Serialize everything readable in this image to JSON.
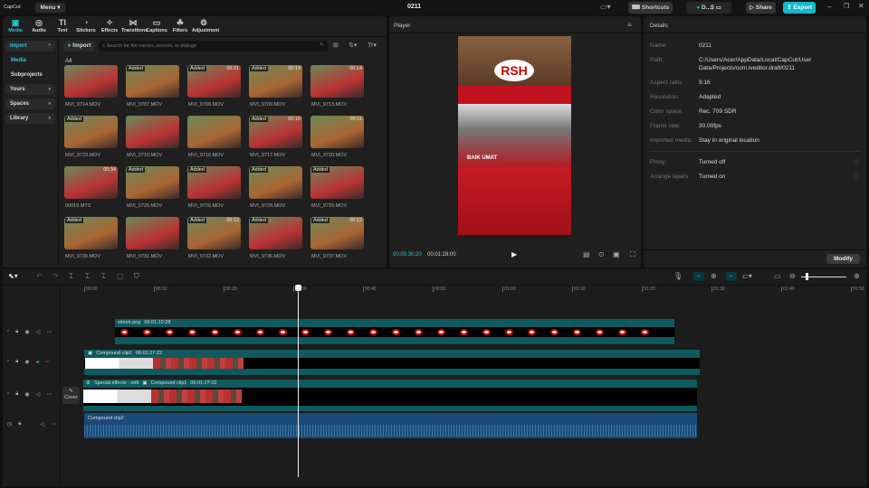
{
  "app": {
    "logo": "CapCut",
    "menu": "Menu",
    "project_title": "0211",
    "shortcuts": "Shortcuts",
    "user": "D...$",
    "share": "Share",
    "export": "Export",
    "accent": "#17b8c9"
  },
  "tabs": [
    {
      "label": "Media",
      "icon": "media-icon"
    },
    {
      "label": "Audio",
      "icon": "audio-icon"
    },
    {
      "label": "Text",
      "icon": "text-icon"
    },
    {
      "label": "Stickers",
      "icon": "stickers-icon"
    },
    {
      "label": "Effects",
      "icon": "effects-icon"
    },
    {
      "label": "Transitions",
      "icon": "transitions-icon"
    },
    {
      "label": "Captions",
      "icon": "captions-icon"
    },
    {
      "label": "Filters",
      "icon": "filters-icon"
    },
    {
      "label": "Adjustment",
      "icon": "adjustment-icon"
    }
  ],
  "sidebar": {
    "import": "Import",
    "media": "Media",
    "subprojects": "Subprojects",
    "yours": "Yours",
    "spaces": "Spaces",
    "library": "Library"
  },
  "media": {
    "import_button": "Import",
    "search_placeholder": "Search for file names, scenes, or dialogs",
    "filter_label": "All",
    "items": [
      {
        "name": "MVI_9714.MOV",
        "added": "",
        "duration": ""
      },
      {
        "name": "MVI_9707.MOV",
        "added": "Added",
        "duration": ""
      },
      {
        "name": "MVI_9708.MOV",
        "added": "Added",
        "duration": "00:21"
      },
      {
        "name": "MVI_9709.MOV",
        "added": "Added",
        "duration": "00:13"
      },
      {
        "name": "MVI_9713.MOV",
        "added": "",
        "duration": "00:14"
      },
      {
        "name": "MVI_9723.MOV",
        "added": "Added",
        "duration": ""
      },
      {
        "name": "MVI_9715.MOV",
        "added": "",
        "duration": ""
      },
      {
        "name": "MVI_9716.MOV",
        "added": "",
        "duration": ""
      },
      {
        "name": "MVI_9717.MOV",
        "added": "Added",
        "duration": "00:10"
      },
      {
        "name": "MVI_9720.MOV",
        "added": "",
        "duration": "00:11"
      },
      {
        "name": "00015.MTS",
        "added": "",
        "duration": "00:34"
      },
      {
        "name": "MVI_9725.MOV",
        "added": "Added",
        "duration": ""
      },
      {
        "name": "MVI_9726.MOV",
        "added": "Added",
        "duration": ""
      },
      {
        "name": "MVI_9728.MOV",
        "added": "Added",
        "duration": ""
      },
      {
        "name": "MVI_9729.MOV",
        "added": "Added",
        "duration": ""
      },
      {
        "name": "MVI_9730.MOV",
        "added": "Added",
        "duration": ""
      },
      {
        "name": "MVI_9731.MOV",
        "added": "",
        "duration": ""
      },
      {
        "name": "MVI_9732.MOV",
        "added": "Added",
        "duration": "00:12"
      },
      {
        "name": "MVI_9736.MOV",
        "added": "Added",
        "duration": ""
      },
      {
        "name": "MVI_9737.MOV",
        "added": "Added",
        "duration": "00:12"
      }
    ]
  },
  "player": {
    "title": "Player",
    "current_time": "00:00:30:20",
    "total_time": "00:01:28:00",
    "overlay_text": "BAIK UMAT"
  },
  "details": {
    "title": "Details",
    "rows": [
      {
        "label": "Name:",
        "value": "0211"
      },
      {
        "label": "Path:",
        "value": "C:/Users/Acer/AppData/Local/CapCut/User Data/Projects/com.lveditor.draft/0211"
      },
      {
        "label": "Aspect ratio:",
        "value": "9:16"
      },
      {
        "label": "Resolution:",
        "value": "Adapted"
      },
      {
        "label": "Color space:",
        "value": "Rec. 709 SDR"
      },
      {
        "label": "Frame rate:",
        "value": "30.00fps"
      },
      {
        "label": "Imported media:",
        "value": "Stay in original location"
      }
    ],
    "rows2": [
      {
        "label": "Proxy:",
        "value": "Turned off"
      },
      {
        "label": "Arrange layers",
        "value": "Turned on"
      }
    ],
    "modify": "Modify"
  },
  "timeline": {
    "ruler": [
      "00:00",
      "00:10",
      "00:20",
      "00:30",
      "00:40",
      "00:50",
      "01:00",
      "01:10",
      "01:20",
      "01:30",
      "01:40",
      "01:50"
    ],
    "zoom_level": 0.1,
    "cover": "Cover",
    "clips": {
      "wtmrk_name": "wtmrk.png",
      "wtmrk_dur": "00:01:19:28",
      "c1_name": "Compound clip1",
      "c1_dur": "00:01:27:22",
      "fx_name": "Special effects - edit",
      "c2_name": "Compound clip1",
      "c2_dur": "00:01:27:22",
      "audio_name": "Compound clip2"
    }
  }
}
